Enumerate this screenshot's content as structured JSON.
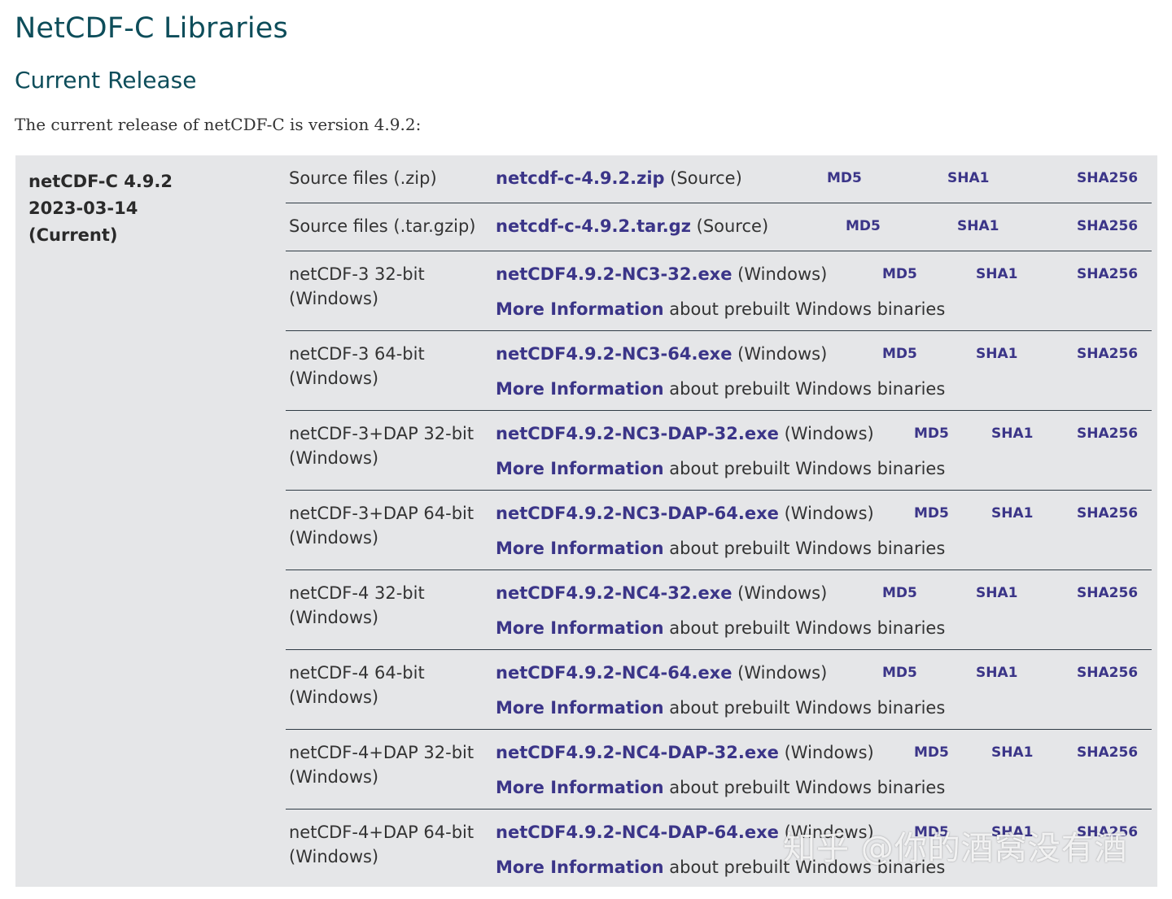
{
  "page": {
    "title": "NetCDF-C Libraries",
    "section_title": "Current Release",
    "intro": "The current release of netCDF-C is version 4.9.2:"
  },
  "release": {
    "version": "netCDF-C 4.9.2",
    "date": "2023-03-14",
    "status": "(Current)"
  },
  "colors": {
    "heading": "#0d4d5a",
    "link": "#3b3588",
    "panel_background": "#e5e6e8"
  },
  "files": [
    {
      "type": "Source files (.zip)",
      "link": "netcdf-c-4.9.2.zip",
      "platform": "(Source)",
      "md5": "MD5",
      "sha1": "SHA1",
      "sha256": "SHA256"
    },
    {
      "type": "Source files (.tar.gzip)",
      "link": "netcdf-c-4.9.2.tar.gz",
      "platform": "(Source)",
      "md5": "MD5",
      "sha1": "SHA1",
      "sha256": "SHA256"
    },
    {
      "type": "netCDF-3 32-bit (Windows)",
      "link": "netCDF4.9.2-NC3-32.exe",
      "platform": "(Windows)",
      "more_link": "More Information",
      "more_text": "about prebuilt Windows binaries",
      "md5": "MD5",
      "sha1": "SHA1",
      "sha256": "SHA256"
    },
    {
      "type": "netCDF-3 64-bit (Windows)",
      "link": "netCDF4.9.2-NC3-64.exe",
      "platform": "(Windows)",
      "more_link": "More Information",
      "more_text": "about prebuilt Windows binaries",
      "md5": "MD5",
      "sha1": "SHA1",
      "sha256": "SHA256"
    },
    {
      "type": "netCDF-3+DAP 32-bit (Windows)",
      "link": "netCDF4.9.2-NC3-DAP-32.exe",
      "platform": "(Windows)",
      "more_link": "More Information",
      "more_text": "about prebuilt Windows binaries",
      "md5": "MD5",
      "sha1": "SHA1",
      "sha256": "SHA256"
    },
    {
      "type": "netCDF-3+DAP 64-bit (Windows)",
      "link": "netCDF4.9.2-NC3-DAP-64.exe",
      "platform": "(Windows)",
      "more_link": "More Information",
      "more_text": "about prebuilt Windows binaries",
      "md5": "MD5",
      "sha1": "SHA1",
      "sha256": "SHA256"
    },
    {
      "type": "netCDF-4 32-bit (Windows)",
      "link": "netCDF4.9.2-NC4-32.exe",
      "platform": "(Windows)",
      "more_link": "More Information",
      "more_text": "about prebuilt Windows binaries",
      "md5": "MD5",
      "sha1": "SHA1",
      "sha256": "SHA256"
    },
    {
      "type": "netCDF-4 64-bit (Windows)",
      "link": "netCDF4.9.2-NC4-64.exe",
      "platform": "(Windows)",
      "more_link": "More Information",
      "more_text": "about prebuilt Windows binaries",
      "md5": "MD5",
      "sha1": "SHA1",
      "sha256": "SHA256"
    },
    {
      "type": "netCDF-4+DAP 32-bit (Windows)",
      "link": "netCDF4.9.2-NC4-DAP-32.exe",
      "platform": "(Windows)",
      "more_link": "More Information",
      "more_text": "about prebuilt Windows binaries",
      "md5": "MD5",
      "sha1": "SHA1",
      "sha256": "SHA256"
    },
    {
      "type": "netCDF-4+DAP 64-bit (Windows)",
      "link": "netCDF4.9.2-NC4-DAP-64.exe",
      "platform": "(Windows)",
      "more_link": "More Information",
      "more_text": "about prebuilt Windows binaries",
      "md5": "MD5",
      "sha1": "SHA1",
      "sha256": "SHA256"
    }
  ],
  "watermark": "知乎 @你的酒窝没有酒"
}
